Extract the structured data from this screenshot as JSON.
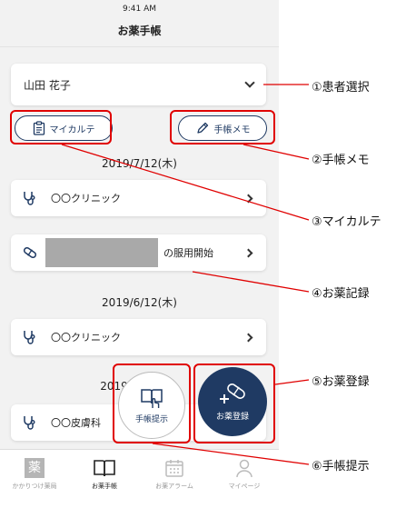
{
  "status": {
    "time": "9:41 AM"
  },
  "header": {
    "title": "お薬手帳"
  },
  "patient": {
    "name": "山田 花子"
  },
  "buttons": {
    "karte": "マイカルテ",
    "memo": "手帳メモ"
  },
  "entries": [
    {
      "date": "2019/7/12(木)",
      "rows": [
        {
          "type": "clinic",
          "label": "〇〇クリニック"
        },
        {
          "type": "medicine",
          "label": "の服用開始"
        }
      ]
    },
    {
      "date": "2019/6/12(木)",
      "rows": [
        {
          "type": "clinic",
          "label": "〇〇クリニック"
        }
      ]
    },
    {
      "date": "2019",
      "rows": [
        {
          "type": "clinic",
          "label": "〇〇皮膚科"
        }
      ]
    }
  ],
  "fab": {
    "present": "手帳提示",
    "register": "お薬登録"
  },
  "tabs": [
    {
      "label": "かかりつけ薬局",
      "icon": "pharmacy-icon",
      "glyph": "薬"
    },
    {
      "label": "お薬手帳",
      "icon": "book-icon"
    },
    {
      "label": "お薬アラーム",
      "icon": "calendar-icon"
    },
    {
      "label": "マイページ",
      "icon": "person-icon"
    }
  ],
  "callouts": [
    "①患者選択",
    "②手帳メモ",
    "③マイカルテ",
    "④お薬記録",
    "⑤お薬登録",
    "⑥手帳提示"
  ],
  "colors": {
    "navy": "#1f3a63",
    "annotation": "#e00000",
    "background": "#f2f2f2"
  }
}
